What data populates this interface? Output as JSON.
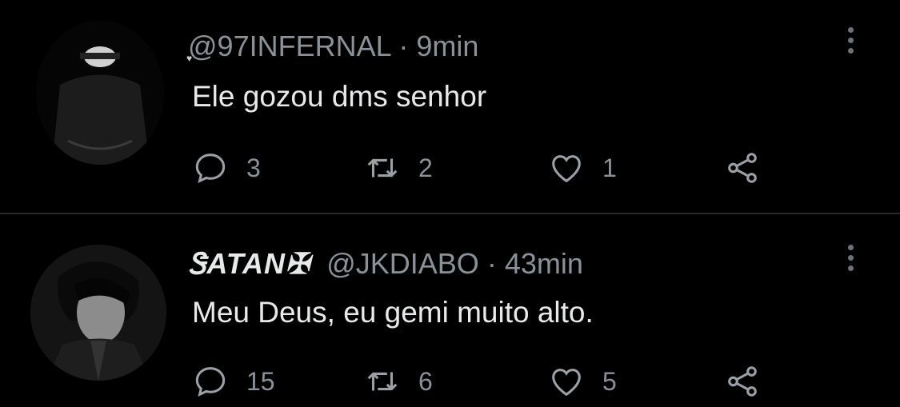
{
  "tweets": [
    {
      "display_name": "",
      "handle": "@97INFERNAL",
      "separator": "·",
      "time": "9min",
      "text": "Ele gozou dms senhor",
      "replies": "3",
      "retweets": "2",
      "likes": "1"
    },
    {
      "display_name": "ᏕATAN✠",
      "handle": "@JKDIABO",
      "separator": "·",
      "time": "43min",
      "text": "Meu Deus, eu gemi muito alto.",
      "replies": "15",
      "retweets": "6",
      "likes": "5"
    }
  ],
  "icons": [
    "reply-icon",
    "retweet-icon",
    "like-icon",
    "share-icon",
    "more-icon"
  ],
  "colors": {
    "background": "#000000",
    "text": "#e7e9ea",
    "muted": "#8b9198"
  }
}
